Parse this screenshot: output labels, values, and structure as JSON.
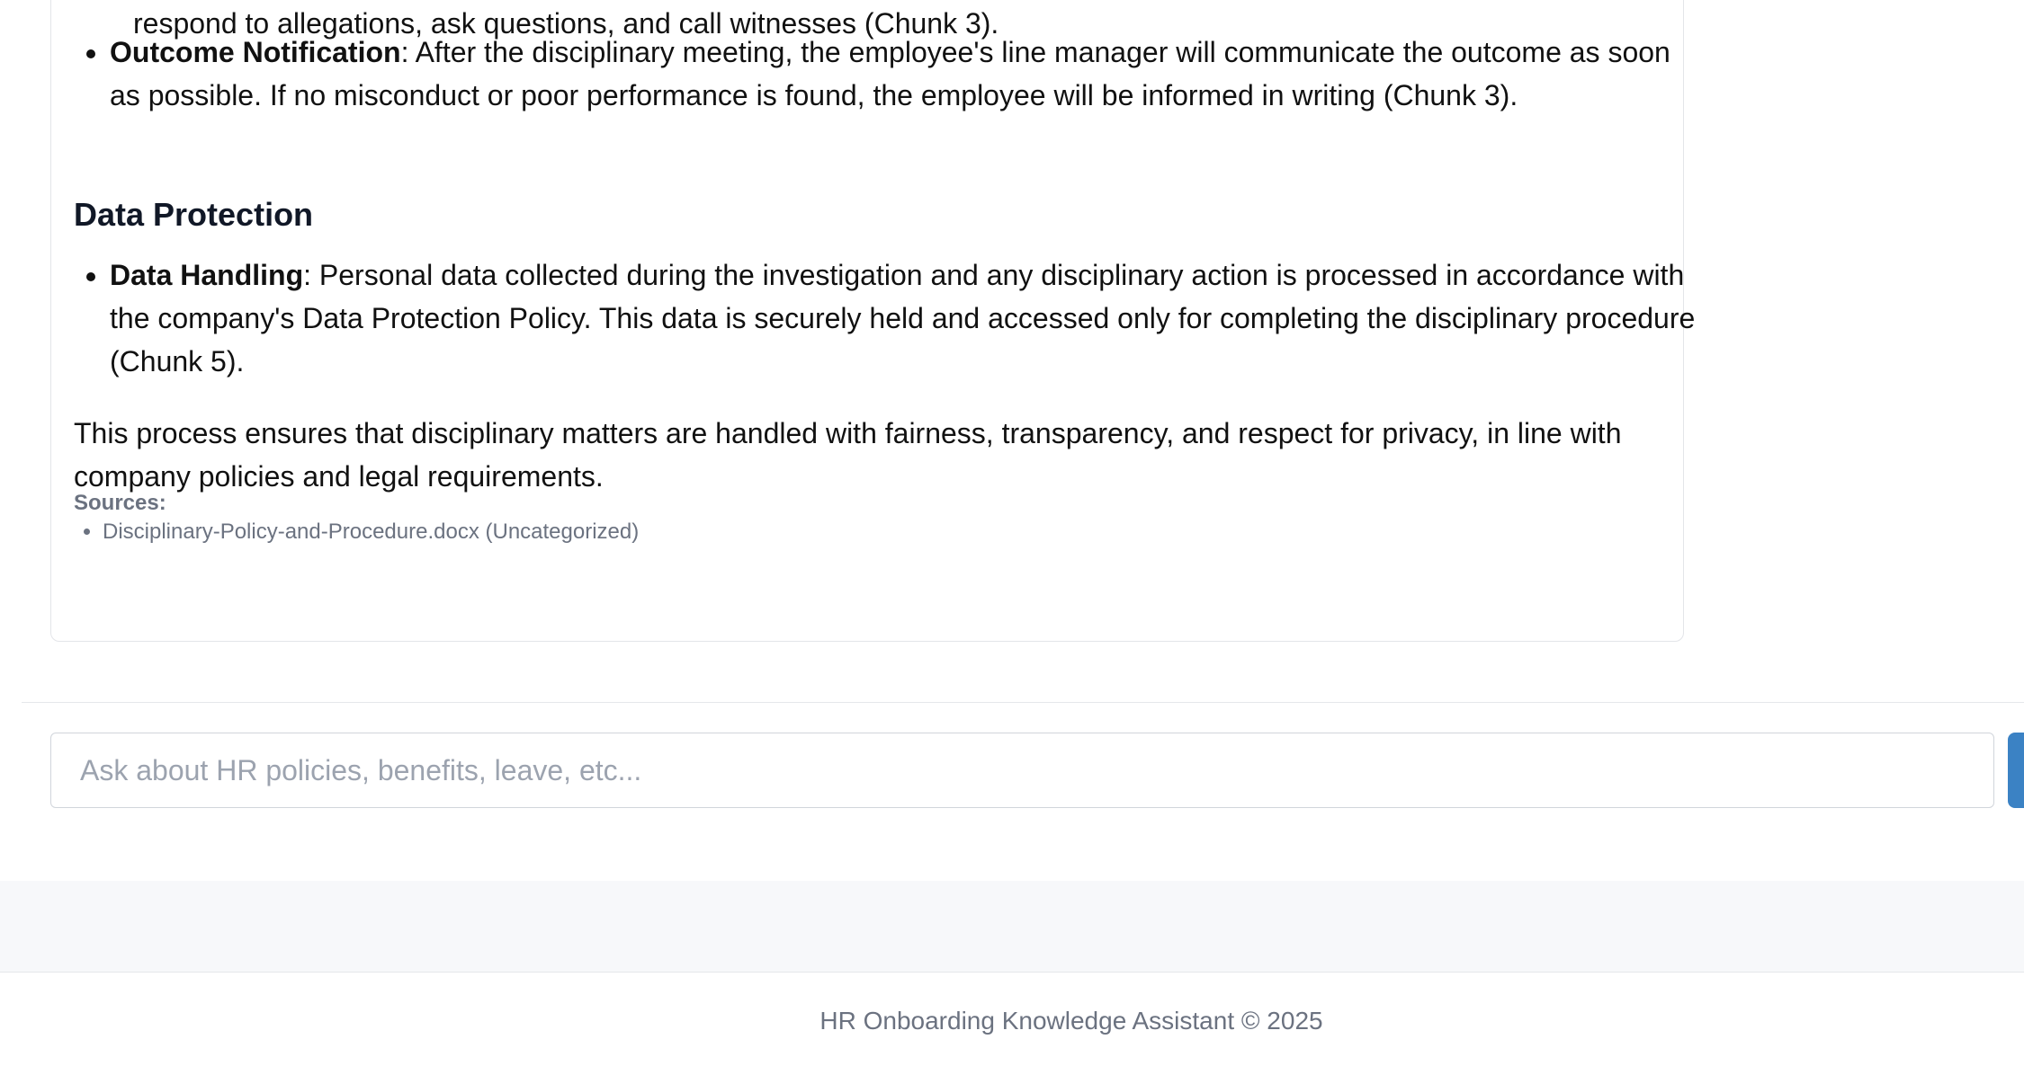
{
  "message": {
    "previous_line": "respond to allegations, ask questions, and call witnesses (Chunk 3).",
    "outcome": {
      "title": "Outcome Notification",
      "text": ": After the disciplinary meeting, the employee's line manager will communicate the outcome as soon as possible. If no misconduct or poor performance is found, the employee will be informed in writing (Chunk 3)."
    },
    "data_protection": {
      "heading": "Data Protection",
      "item_title": "Data Handling",
      "item_text": ": Personal data collected during the investigation and any disciplinary action is processed in accordance with the company's Data Protection Policy. This data is securely held and accessed only for completing the disciplinary procedure (Chunk 5)."
    },
    "closing": "This process ensures that disciplinary matters are handled with fairness, transparency, and respect for privacy, in line with company policies and legal requirements.",
    "sources": {
      "label": "Sources:",
      "items": [
        "Disciplinary-Policy-and-Procedure.docx (Uncategorized)"
      ]
    }
  },
  "input": {
    "placeholder": "Ask about HR policies, benefits, leave, etc...",
    "value": ""
  },
  "send_button": {
    "color": "#3b82c4"
  },
  "footer": {
    "text": "HR Onboarding Knowledge Assistant © 2025"
  }
}
